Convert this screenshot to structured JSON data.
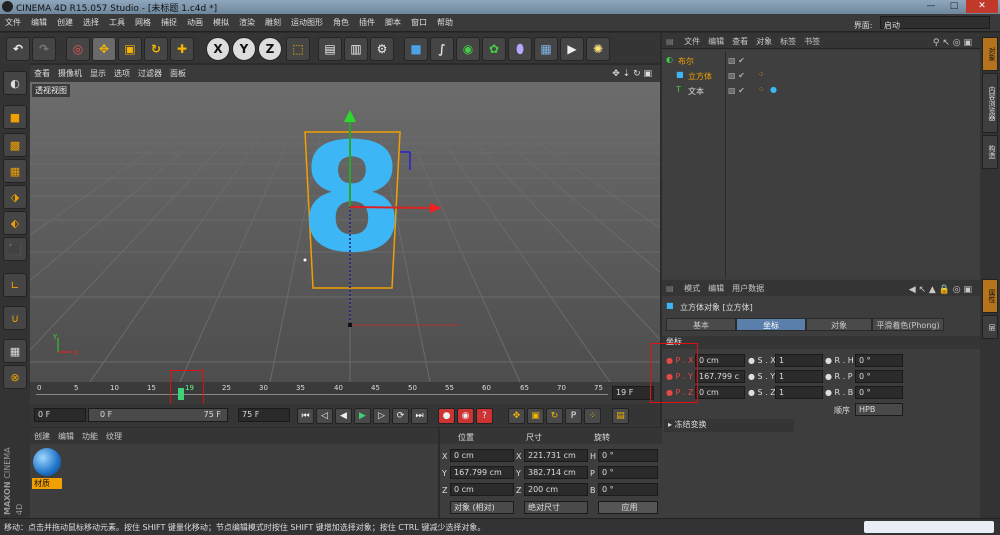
{
  "titlebar": {
    "title": "CINEMA 4D R15.057 Studio - [未标题 1.c4d *]",
    "min": "—",
    "max": "□",
    "close": "✕"
  },
  "menu": [
    "文件",
    "编辑",
    "创建",
    "选择",
    "工具",
    "网格",
    "捕捉",
    "动画",
    "模拟",
    "渲染",
    "雕刻",
    "运动图形",
    "角色",
    "插件",
    "脚本",
    "窗口",
    "帮助"
  ],
  "interface": {
    "label": "界面:",
    "value": "启动"
  },
  "toolbar": {
    "x": "X",
    "y": "Y",
    "z": "Z"
  },
  "viewport": {
    "menu": [
      "查看",
      "摄像机",
      "显示",
      "选项",
      "过滤器",
      "面板"
    ],
    "label": "透视视图",
    "digit": "8",
    "axis_x": "X",
    "axis_y": "Y"
  },
  "timeline": {
    "ticks": [
      "0",
      "5",
      "10",
      "15",
      "19",
      "25",
      "30",
      "35",
      "40",
      "45",
      "50",
      "55",
      "60",
      "65",
      "70",
      "75"
    ],
    "current": "19",
    "frame_box": "19 F"
  },
  "transport": {
    "start": "0 F",
    "range_start": "0 F",
    "range_end": "75 F",
    "end": "75 F"
  },
  "materials": {
    "menu": [
      "创建",
      "编辑",
      "功能",
      "纹理"
    ],
    "material_name": "材质"
  },
  "coords": {
    "headers": [
      "位置",
      "尺寸",
      "旋转"
    ],
    "rows": [
      {
        "a": "X",
        "pos": "0 cm",
        "b": "X",
        "size": "221.731 cm",
        "c": "H",
        "rot": "0 °"
      },
      {
        "a": "Y",
        "pos": "167.799 cm",
        "b": "Y",
        "size": "382.714 cm",
        "c": "P",
        "rot": "0 °"
      },
      {
        "a": "Z",
        "pos": "0 cm",
        "b": "Z",
        "size": "200 cm",
        "c": "B",
        "rot": "0 °"
      }
    ],
    "mode": "对象 (相对)",
    "size_mode": "绝对尺寸",
    "apply": "应用"
  },
  "object_manager": {
    "menu": [
      "文件",
      "编辑",
      "查看",
      "对象",
      "标签",
      "书签"
    ],
    "items": [
      {
        "name": "布尔",
        "indent": 0
      },
      {
        "name": "立方体",
        "indent": 1
      },
      {
        "name": "文本",
        "indent": 1
      }
    ]
  },
  "attributes": {
    "menu": [
      "模式",
      "编辑",
      "用户数据"
    ],
    "title": "立方体对象 [立方体]",
    "tabs": [
      "基本",
      "坐标",
      "对象",
      "平滑着色(Phong)"
    ],
    "section": "坐标",
    "rows": [
      {
        "p": "P . X",
        "pv": "0 cm",
        "s": "S . X",
        "sv": "1",
        "r": "R . H",
        "rv": "0 °"
      },
      {
        "p": "P . Y",
        "pv": "167.799 c",
        "s": "S . Y",
        "sv": "1",
        "r": "R . P",
        "rv": "0 °"
      },
      {
        "p": "P . Z",
        "pv": "0 cm",
        "s": "S . Z",
        "sv": "1",
        "r": "R . B",
        "rv": "0 °"
      }
    ],
    "order_label": "顺序",
    "order_value": "HPB",
    "freeze": "冻结变换"
  },
  "right_tabs": [
    "对象",
    "内容浏览器",
    "构造",
    "属性",
    "层"
  ],
  "status": "移动：点击并拖动鼠标移动元素。按住 SHIFT 键量化移动；节点编辑模式时按住 SHIFT 键增加选择对象；按住 CTRL 键减少选择对象。",
  "brand": {
    "maxon": "MAXON",
    "c4d": "CINEMA 4D"
  }
}
